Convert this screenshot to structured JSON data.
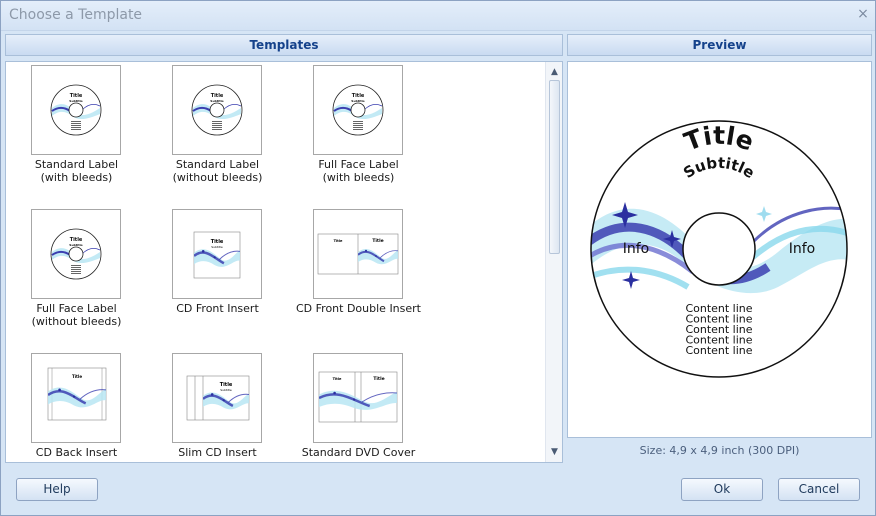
{
  "window": {
    "title": "Choose a Template",
    "close_glyph": "×"
  },
  "headers": {
    "templates": "Templates",
    "preview": "Preview"
  },
  "templates": [
    {
      "label": "Standard Label\n(with bleeds)",
      "kind": "disc"
    },
    {
      "label": "Standard Label\n(without bleeds)",
      "kind": "disc"
    },
    {
      "label": "Full Face Label\n(with bleeds)",
      "kind": "disc"
    },
    {
      "label": "Full Face Label\n(without bleeds)",
      "kind": "disc"
    },
    {
      "label": "CD Front Insert",
      "kind": "front"
    },
    {
      "label": "CD Front Double Insert",
      "kind": "double"
    },
    {
      "label": "CD Back Insert",
      "kind": "back"
    },
    {
      "label": "Slim CD Insert",
      "kind": "slim"
    },
    {
      "label": "Standard DVD Cover",
      "kind": "dvd"
    }
  ],
  "thumb_text": {
    "title": "Title",
    "subtitle": "Subtitle"
  },
  "preview": {
    "title": "Title",
    "subtitle": "Subtitle",
    "info_left": "Info",
    "info_right": "Info",
    "content_lines": [
      "Content line",
      "Content line",
      "Content line",
      "Content line",
      "Content line"
    ]
  },
  "size_text": "Size: 4,9 x 4,9 inch (300 DPI)",
  "buttons": {
    "help": "Help",
    "ok": "Ok",
    "cancel": "Cancel"
  },
  "scrollbar": {
    "up_glyph": "▲",
    "down_glyph": "▼"
  },
  "colors": {
    "accent": "#15428b",
    "wave_dark": "#2a2f9e",
    "wave_light": "#7fd3ea",
    "window_bg": "#d6e5f5"
  },
  "icons": [
    "close-icon",
    "scroll-up-icon",
    "scroll-down-icon"
  ]
}
